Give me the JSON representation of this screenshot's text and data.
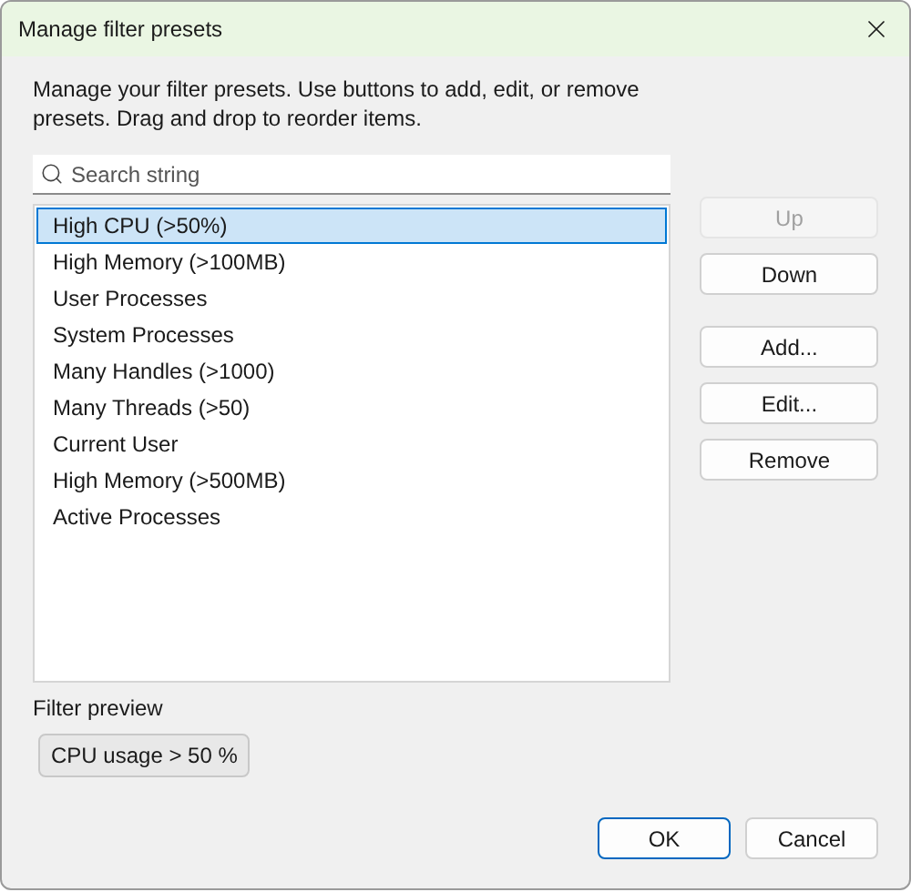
{
  "window": {
    "title": "Manage filter presets"
  },
  "description": "Manage your filter presets. Use buttons to add, edit, or remove presets. Drag and drop to reorder items.",
  "search": {
    "placeholder": "Search string"
  },
  "presets": [
    {
      "label": "High CPU (>50%)",
      "selected": true
    },
    {
      "label": "High Memory (>100MB)",
      "selected": false
    },
    {
      "label": "User Processes",
      "selected": false
    },
    {
      "label": "System Processes",
      "selected": false
    },
    {
      "label": "Many Handles (>1000)",
      "selected": false
    },
    {
      "label": "Many Threads (>50)",
      "selected": false
    },
    {
      "label": "Current User",
      "selected": false
    },
    {
      "label": "High Memory (>500MB)",
      "selected": false
    },
    {
      "label": "Active Processes",
      "selected": false
    }
  ],
  "side_button_groups": [
    [
      {
        "label": "Up",
        "disabled": true
      },
      {
        "label": "Down",
        "disabled": false
      }
    ],
    [
      {
        "label": "Add...",
        "disabled": false
      },
      {
        "label": "Edit...",
        "disabled": false
      },
      {
        "label": "Remove",
        "disabled": false
      }
    ]
  ],
  "preview": {
    "label": "Filter preview",
    "value": "CPU usage > 50 %"
  },
  "footer_buttons": [
    {
      "label": "OK",
      "default": true
    },
    {
      "label": "Cancel",
      "default": false
    }
  ]
}
